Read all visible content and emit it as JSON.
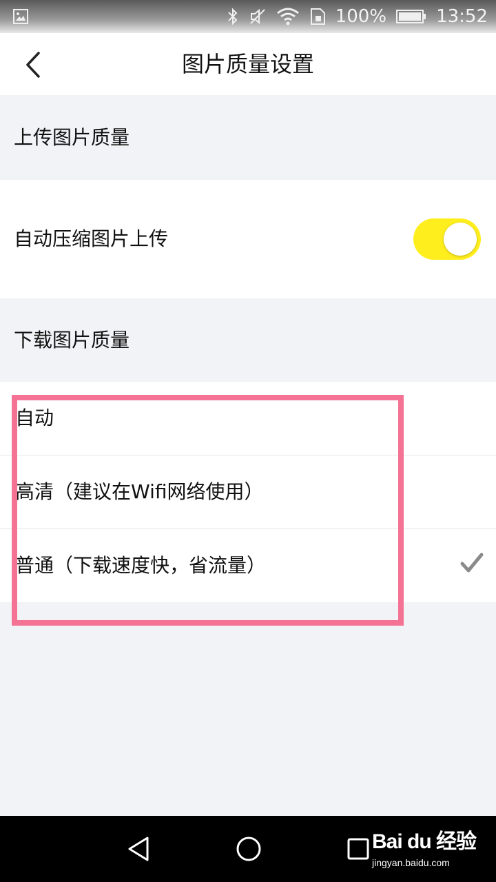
{
  "status_bar": {
    "battery": "100%",
    "time": "13:52"
  },
  "header": {
    "title": "图片质量设置"
  },
  "upload_section": {
    "label": "上传图片质量",
    "auto_compress_label": "自动压缩图片上传",
    "auto_compress_on": true
  },
  "download_section": {
    "label": "下载图片质量",
    "options": [
      {
        "label": "自动",
        "selected": false
      },
      {
        "label": "高清（建议在Wifi网络使用）",
        "selected": false
      },
      {
        "label": "普通（下载速度快，省流量）",
        "selected": true
      }
    ]
  },
  "watermark": {
    "logo": "Bai du 经验",
    "url": "jingyan.baidu.com"
  },
  "colors": {
    "toggle_on": "#ffee1e",
    "highlight_border": "#f47394",
    "background": "#f2f3f7"
  }
}
